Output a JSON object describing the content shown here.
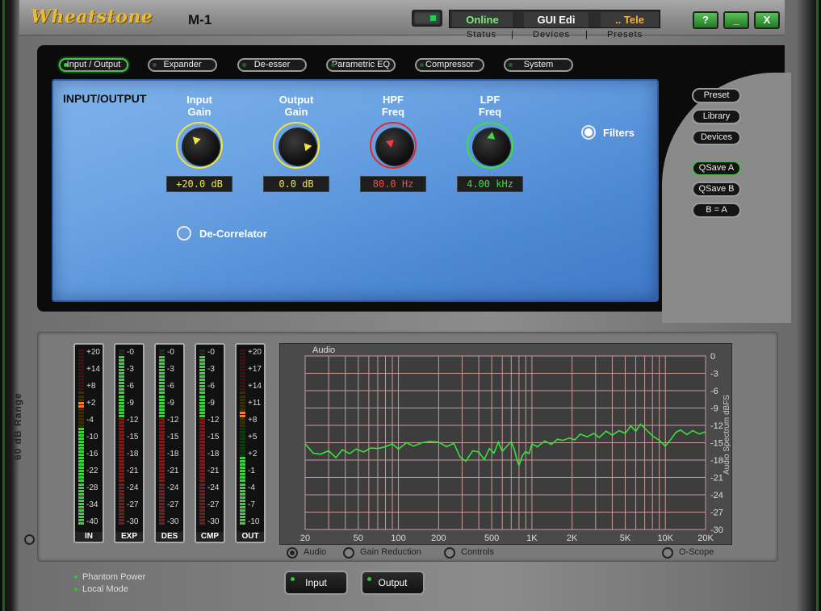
{
  "app": {
    "logo": "Wheatstone",
    "model": "M-1"
  },
  "header": {
    "status_boxes": [
      {
        "text": "Online",
        "color": "#7ee87e"
      },
      {
        "text": "GUI Edi",
        "color": "#ffffff"
      },
      {
        "text": ".. Tele",
        "color": "#f5b23a"
      }
    ],
    "status_labels": [
      "Status",
      "Devices",
      "Presets"
    ],
    "window_buttons": [
      "?",
      "_",
      "X"
    ]
  },
  "tabs": [
    "Input / Output",
    "Expander",
    "De-esser",
    "Parametric EQ",
    "Compressor",
    "System"
  ],
  "active_tab": "Input / Output",
  "io_panel": {
    "title": "INPUT/OUTPUT",
    "knobs": [
      {
        "label1": "Input",
        "label2": "Gain",
        "readout": "+20.0 dB",
        "readout_color": "#f2e53a",
        "ring": "#f2e53a"
      },
      {
        "label1": "Output",
        "label2": "Gain",
        "readout": "0.0 dB",
        "readout_color": "#f2e53a",
        "ring": "#f2e53a"
      },
      {
        "label1": "HPF",
        "label2": "Freq",
        "readout": "80.0 Hz",
        "readout_color": "#ff4a3a",
        "ring": "#e02a2a"
      },
      {
        "label1": "LPF",
        "label2": "Freq",
        "readout": "4.00 kHz",
        "readout_color": "#39e039",
        "ring": "#39e039"
      }
    ],
    "filters_label": "Filters",
    "decorrelator_label": "De-Correlator"
  },
  "side_buttons": [
    "Preset",
    "Library",
    "Devices"
  ],
  "qsave_buttons": [
    "QSave A",
    "QSave B",
    "B = A"
  ],
  "range_label": "60 dB Range",
  "meters": [
    {
      "name": "IN",
      "ticks": [
        "+20",
        "+14",
        "+8",
        "+2",
        "-4",
        "-10",
        "-16",
        "-22",
        "-28",
        "-34",
        "-40"
      ],
      "level": 0.55,
      "peak": 0.68
    },
    {
      "name": "EXP",
      "ticks": [
        "-0",
        "-3",
        "-6",
        "-9",
        "-12",
        "-15",
        "-18",
        "-21",
        "-24",
        "-27",
        "-30"
      ],
      "level": 0.95,
      "peak": null
    },
    {
      "name": "DES",
      "ticks": [
        "-0",
        "-3",
        "-6",
        "-9",
        "-12",
        "-15",
        "-18",
        "-21",
        "-24",
        "-27",
        "-30"
      ],
      "level": 0.95,
      "peak": null
    },
    {
      "name": "CMP",
      "ticks": [
        "-0",
        "-3",
        "-6",
        "-9",
        "-12",
        "-15",
        "-18",
        "-21",
        "-24",
        "-27",
        "-30"
      ],
      "level": 0.95,
      "peak": null
    },
    {
      "name": "OUT",
      "ticks": [
        "+20",
        "+17",
        "+14",
        "+11",
        "+8",
        "+5",
        "+2",
        "-1",
        "-4",
        "-7",
        "-10"
      ],
      "level": 0.38,
      "peak": 0.62
    }
  ],
  "spectrum": {
    "title": "Audio",
    "y_axis_label": "Audio Spectrum dBFS",
    "x_ticks": [
      "20",
      "50",
      "100",
      "200",
      "500",
      "1K",
      "2K",
      "5K",
      "10K",
      "20K"
    ],
    "y_ticks": [
      "0",
      "-3",
      "-6",
      "-9",
      "-12",
      "-15",
      "-18",
      "-21",
      "-24",
      "-27",
      "-30"
    ]
  },
  "chart_data": {
    "type": "line",
    "xlabel": "",
    "ylabel": "Audio Spectrum dBFS",
    "ylim": [
      -30,
      0
    ],
    "xscale": "log",
    "xlim": [
      20,
      20000
    ],
    "series": [
      {
        "values": [
          [
            20,
            -15.2
          ],
          [
            23,
            -16.8
          ],
          [
            26,
            -17.0
          ],
          [
            30,
            -16.4
          ],
          [
            34,
            -17.6
          ],
          [
            38,
            -16.2
          ],
          [
            43,
            -16.9
          ],
          [
            48,
            -16.1
          ],
          [
            55,
            -16.6
          ],
          [
            62,
            -15.9
          ],
          [
            70,
            -16.0
          ],
          [
            80,
            -15.7
          ],
          [
            90,
            -15.2
          ],
          [
            100,
            -16.1
          ],
          [
            115,
            -15.0
          ],
          [
            130,
            -15.6
          ],
          [
            150,
            -15.0
          ],
          [
            170,
            -14.8
          ],
          [
            200,
            -14.9
          ],
          [
            230,
            -15.7
          ],
          [
            260,
            -15.1
          ],
          [
            290,
            -17.5
          ],
          [
            320,
            -18.2
          ],
          [
            360,
            -16.4
          ],
          [
            400,
            -16.6
          ],
          [
            440,
            -17.9
          ],
          [
            480,
            -16.0
          ],
          [
            520,
            -16.8
          ],
          [
            560,
            -14.9
          ],
          [
            600,
            -16.5
          ],
          [
            650,
            -15.6
          ],
          [
            700,
            -14.8
          ],
          [
            740,
            -16.3
          ],
          [
            780,
            -18.3
          ],
          [
            800,
            -18.9
          ],
          [
            850,
            -17.2
          ],
          [
            900,
            -16.5
          ],
          [
            950,
            -16.9
          ],
          [
            1000,
            -15.2
          ],
          [
            1100,
            -15.7
          ],
          [
            1250,
            -14.7
          ],
          [
            1400,
            -15.3
          ],
          [
            1550,
            -14.4
          ],
          [
            1700,
            -14.6
          ],
          [
            1900,
            -14.2
          ],
          [
            2100,
            -14.5
          ],
          [
            2300,
            -13.5
          ],
          [
            2600,
            -14.0
          ],
          [
            2900,
            -13.4
          ],
          [
            3200,
            -14.1
          ],
          [
            3600,
            -13.0
          ],
          [
            4000,
            -13.7
          ],
          [
            4500,
            -12.9
          ],
          [
            5000,
            -13.4
          ],
          [
            5500,
            -12.1
          ],
          [
            6000,
            -13.0
          ],
          [
            6500,
            -11.8
          ],
          [
            7000,
            -12.5
          ],
          [
            8000,
            -13.8
          ],
          [
            9000,
            -14.6
          ],
          [
            10000,
            -15.6
          ],
          [
            11000,
            -14.4
          ],
          [
            12000,
            -13.2
          ],
          [
            13000,
            -12.8
          ],
          [
            14500,
            -13.6
          ],
          [
            16000,
            -12.9
          ],
          [
            18000,
            -13.5
          ],
          [
            20000,
            -13.1
          ]
        ]
      }
    ]
  },
  "view_options": [
    {
      "label": "Audio",
      "selected": true
    },
    {
      "label": "Gain Reduction",
      "selected": false
    },
    {
      "label": "Controls",
      "selected": false
    },
    {
      "label": "O-Scope",
      "selected": false
    }
  ],
  "status_lines": [
    "Phantom Power",
    "Local Mode"
  ],
  "bottom_buttons": [
    "Input",
    "Output"
  ]
}
